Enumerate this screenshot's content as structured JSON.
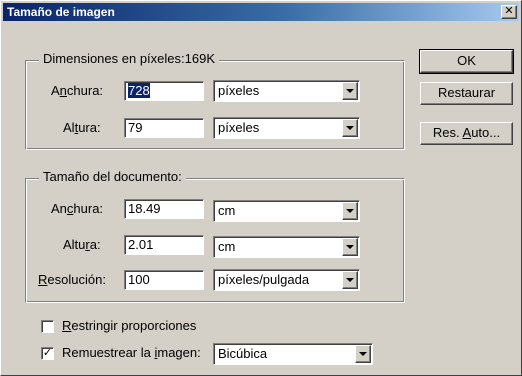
{
  "window": {
    "title": "Tamaño de imagen",
    "close_glyph": "✕"
  },
  "pixel_dimensions": {
    "legend": "Dimensiones en píxeles:169K",
    "width": {
      "label": "Anchura:",
      "value": "728",
      "unit": "píxeles"
    },
    "height": {
      "label": "Altura:",
      "value": "79",
      "unit": "píxeles"
    }
  },
  "document_size": {
    "legend": "Tamaño del documento:",
    "width": {
      "label": "Anchura:",
      "value": "18.49",
      "unit": "cm"
    },
    "height": {
      "label": "Altura:",
      "value": "2.01",
      "unit": "cm"
    },
    "resolution": {
      "label": "Resolución:",
      "value": "100",
      "unit": "píxeles/pulgada"
    }
  },
  "options": {
    "constrain": {
      "label": "Restringir proporciones",
      "checked": false
    },
    "resample": {
      "label": "Remuestrear la imagen:",
      "checked": true,
      "method": "Bicúbica"
    }
  },
  "buttons": {
    "ok": "OK",
    "reset": "Restaurar",
    "auto": "Res. Auto..."
  },
  "colors": {
    "title_start": "#0a246a",
    "title_end": "#a6caf0",
    "face": "#d4d0c8"
  }
}
